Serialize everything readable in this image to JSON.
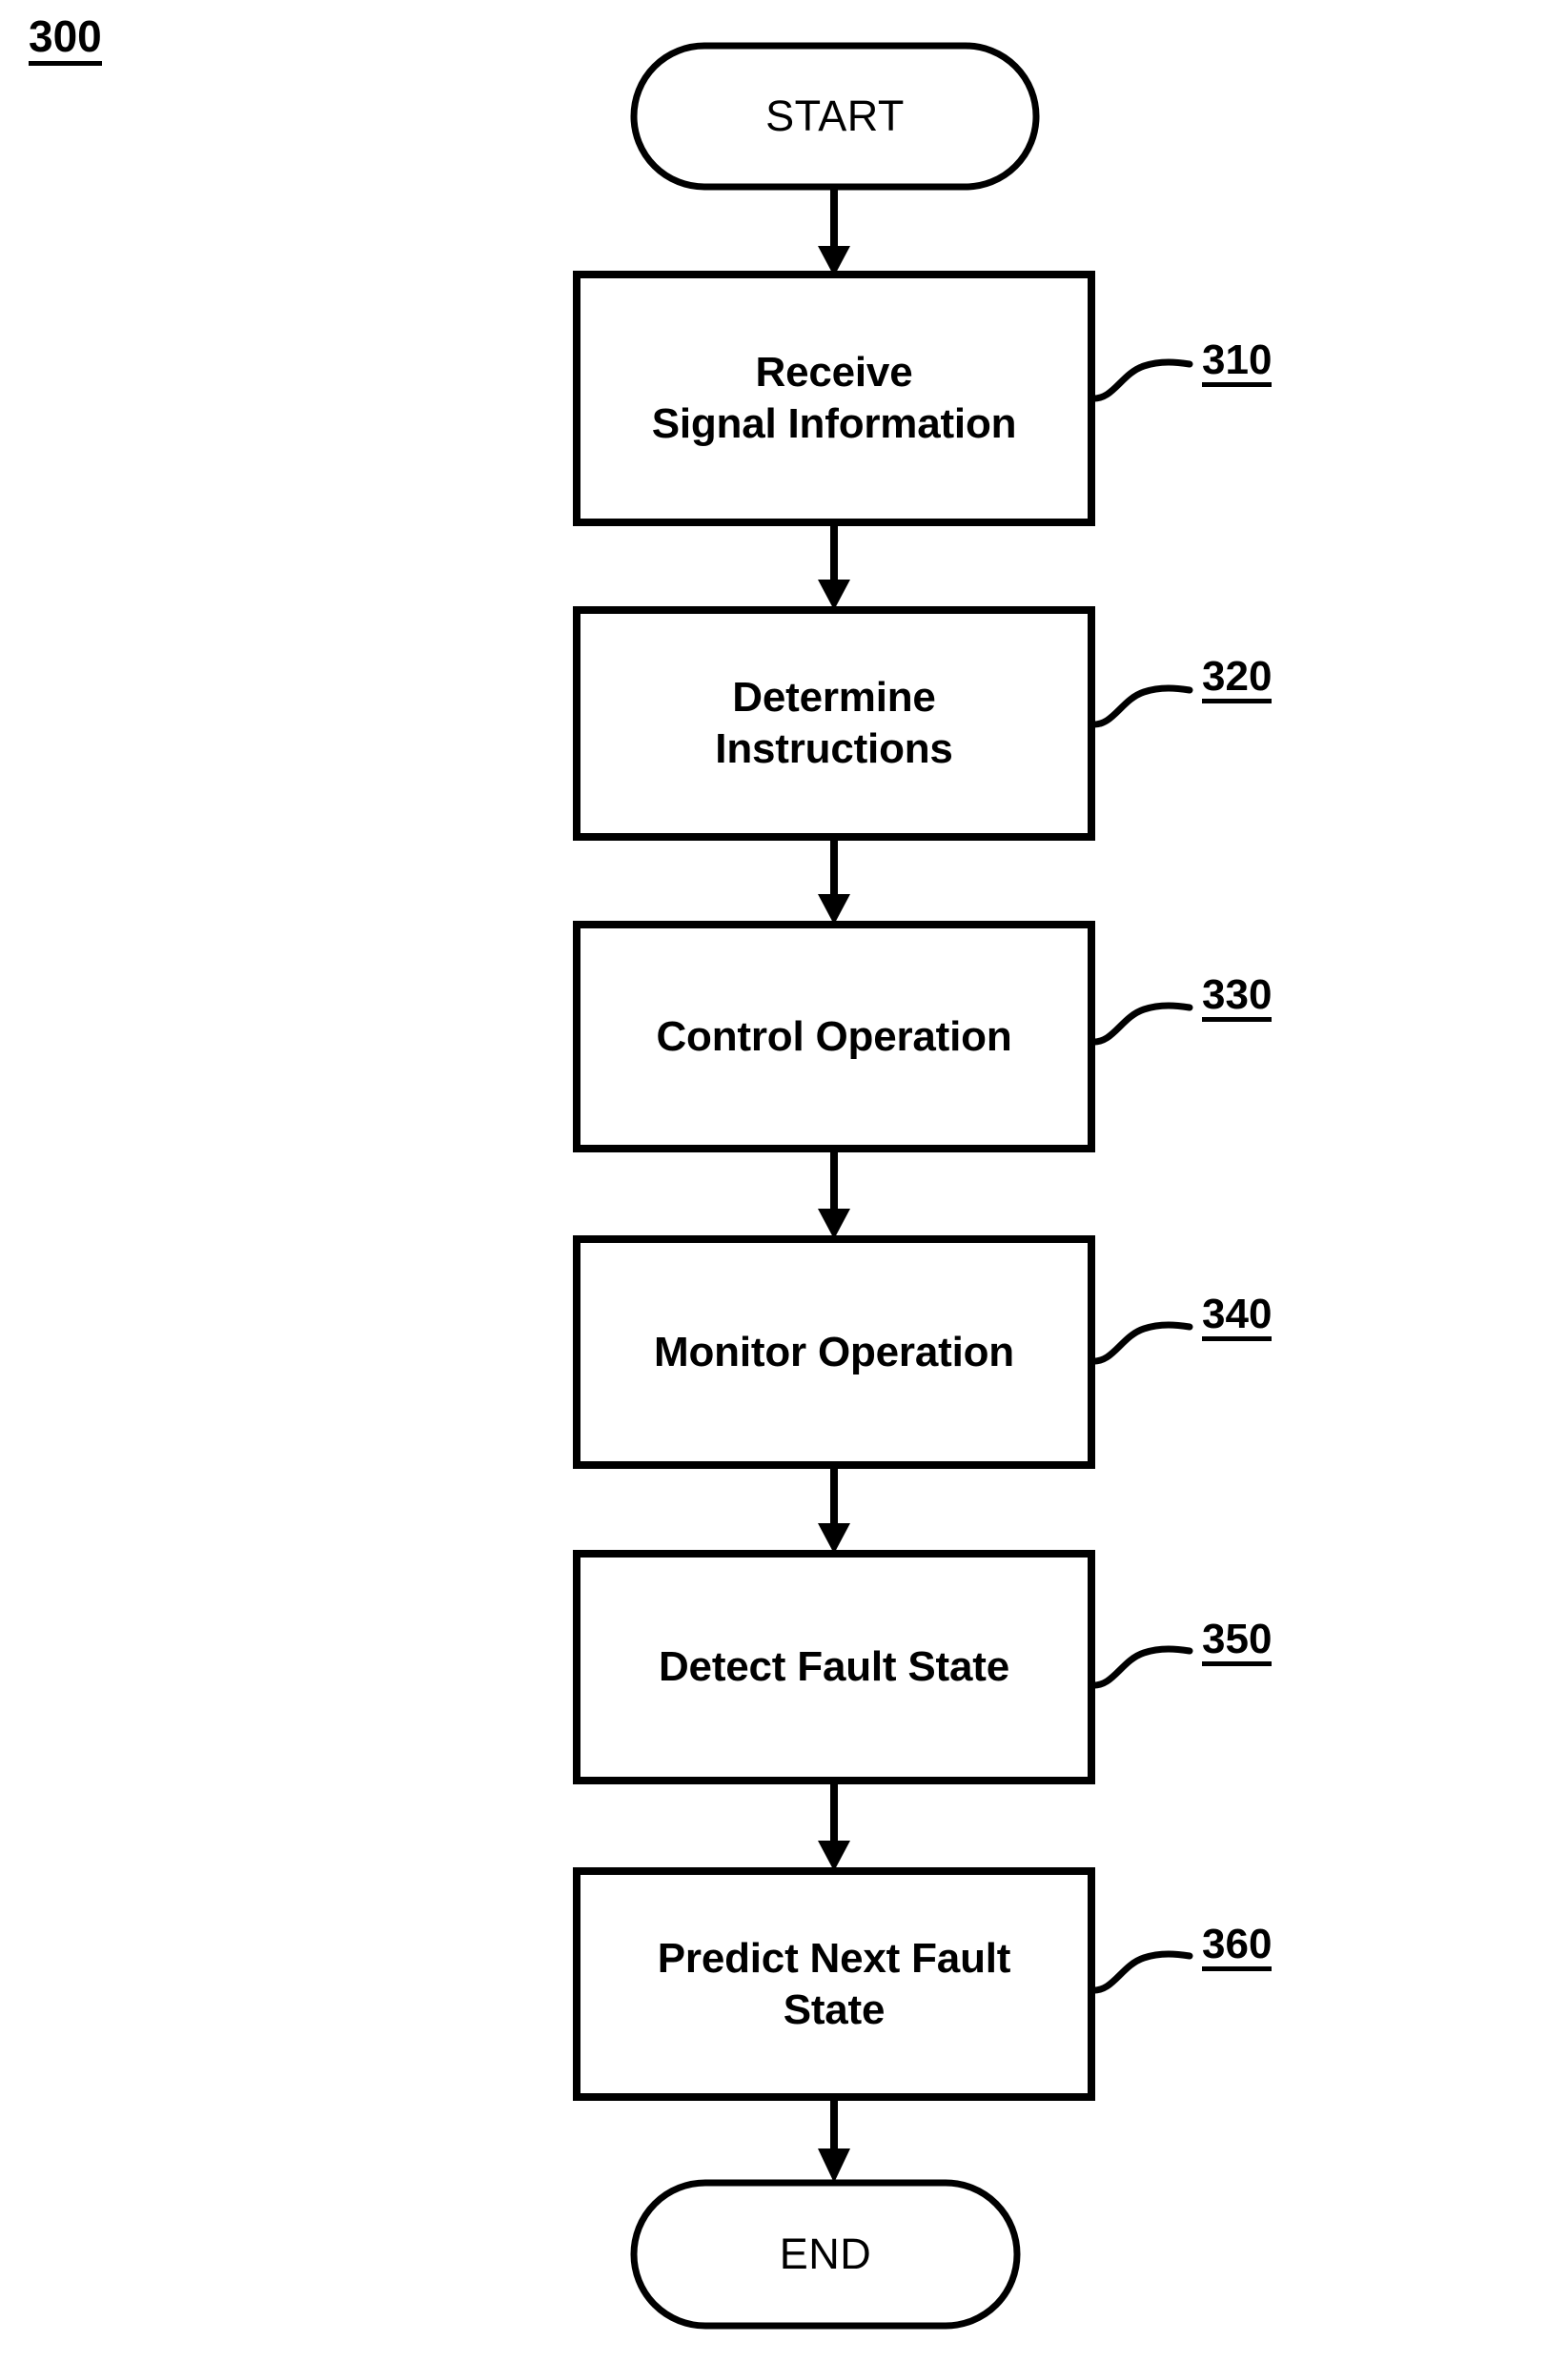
{
  "figure": {
    "number": "300",
    "type": "flowchart",
    "title_label": "300"
  },
  "nodes": {
    "start": {
      "label": "START",
      "shape": "stadium"
    },
    "end": {
      "label": "END",
      "shape": "stadium"
    },
    "steps": [
      {
        "ref": "310",
        "line1": "Receive",
        "line2": "Signal Information",
        "text": "Receive\nSignal Information"
      },
      {
        "ref": "320",
        "line1": "Determine",
        "line2": "Instructions",
        "text": "Determine\nInstructions"
      },
      {
        "ref": "330",
        "line1": "Control Operation",
        "line2": "",
        "text": "Control Operation"
      },
      {
        "ref": "340",
        "line1": "Monitor Operation",
        "line2": "",
        "text": "Monitor Operation"
      },
      {
        "ref": "350",
        "line1": "Detect Fault State",
        "line2": "",
        "text": "Detect Fault State"
      },
      {
        "ref": "360",
        "line1": "Predict Next Fault",
        "line2": "State",
        "text": "Predict Next Fault\nState"
      }
    ]
  },
  "colors": {
    "stroke": "#000000",
    "fill": "#ffffff",
    "text": "#000000"
  }
}
